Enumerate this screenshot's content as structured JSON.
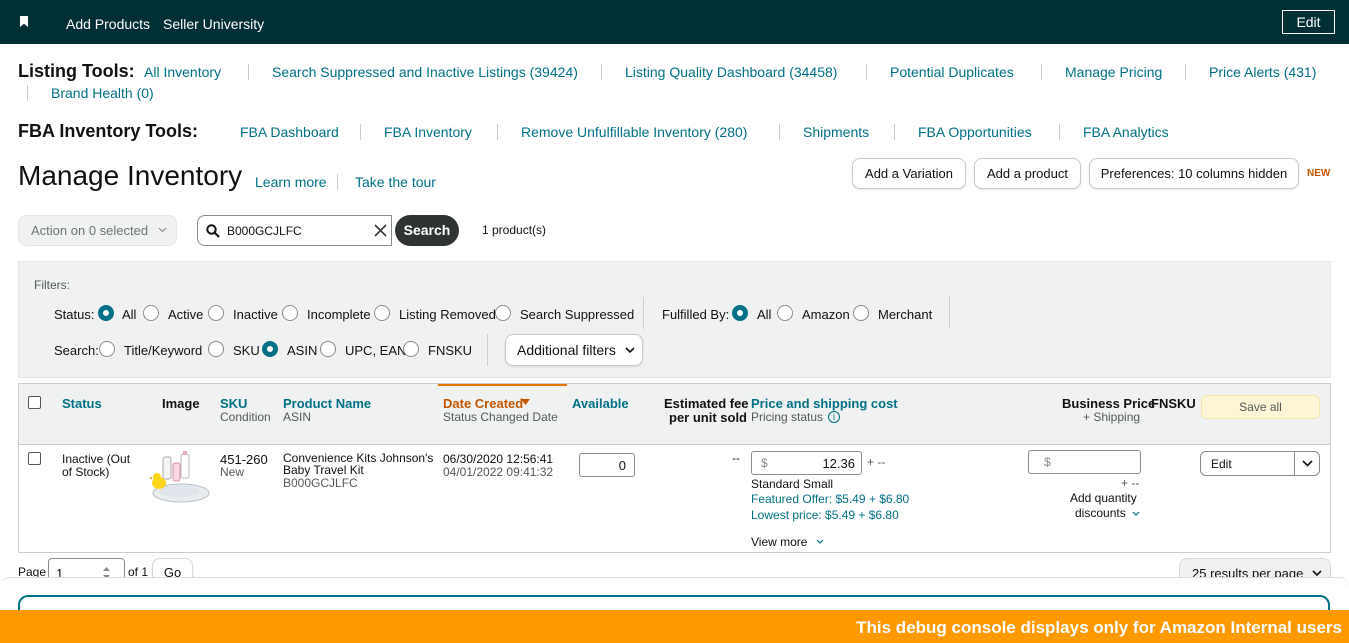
{
  "topbar": {
    "nav": [
      "Add Products",
      "Seller University"
    ],
    "edit_label": "Edit"
  },
  "listing_tools": {
    "label": "Listing Tools:",
    "links": [
      "All Inventory",
      "Search Suppressed and Inactive Listings (39424)",
      "Listing Quality Dashboard (34458)",
      "Potential Duplicates",
      "Manage Pricing",
      "Price Alerts (431)",
      "Brand Health (0)"
    ]
  },
  "fba_tools": {
    "label": "FBA Inventory Tools:",
    "links": [
      "FBA Dashboard",
      "FBA Inventory",
      "Remove Unfulfillable Inventory (280)",
      "Shipments",
      "FBA Opportunities",
      "FBA Analytics"
    ]
  },
  "header": {
    "title": "Manage Inventory",
    "learn_more": "Learn more",
    "take_tour": "Take the tour",
    "add_variation": "Add a Variation",
    "add_product": "Add a product",
    "preferences": "Preferences: 10 columns hidden",
    "new_tag": "NEW"
  },
  "search": {
    "action_label": "Action on 0 selected",
    "value": "B000GCJLFC",
    "button": "Search",
    "count": "1 product(s)"
  },
  "filters": {
    "title": "Filters:",
    "status_label": "Status:",
    "status_options": [
      "All",
      "Active",
      "Inactive",
      "Incomplete",
      "Listing Removed",
      "Search Suppressed"
    ],
    "fulfilled_label": "Fulfilled By:",
    "fulfilled_options": [
      "All",
      "Amazon",
      "Merchant"
    ],
    "search_label": "Search:",
    "search_options": [
      "Title/Keyword",
      "SKU",
      "ASIN",
      "UPC, EAN",
      "FNSKU"
    ],
    "additional": "Additional filters"
  },
  "table": {
    "headers": {
      "status": "Status",
      "image": "Image",
      "sku": "SKU",
      "condition": "Condition",
      "product_name": "Product Name",
      "asin": "ASIN",
      "date_created": "Date Created",
      "status_changed": "Status Changed Date",
      "available": "Available",
      "est_fee_1": "Estimated fee",
      "est_fee_2": "per unit sold",
      "price_shipping": "Price and shipping cost",
      "pricing_status": "Pricing status",
      "business_price": "Business Price",
      "plus_shipping": "+ Shipping",
      "fnsku": "FNSKU",
      "save_all": "Save all"
    },
    "row": {
      "status_1": "Inactive (Out",
      "status_2": "of Stock)",
      "sku": "451-260",
      "condition": "New",
      "name_1": "Convenience Kits Johnson's",
      "name_2": "Baby Travel Kit",
      "asin": "B000GCJLFC",
      "date_created": "06/30/2020 12:56:41",
      "status_changed": "04/01/2022 09:41:32",
      "available": "0",
      "est_fee": "--",
      "currency": "$",
      "price": "12.36",
      "shipping": "+ --",
      "size_tier": "Standard Small",
      "featured_offer": "Featured Offer: $5.49 + $6.80",
      "lowest_price": "Lowest price: $5.49 + $6.80",
      "view_more": "View more",
      "business_currency": "$",
      "business_shipping": "+ --",
      "add_qty_1": "Add quantity",
      "add_qty_2": "discounts",
      "edit": "Edit"
    }
  },
  "pagination": {
    "page_label": "Page",
    "page_value": "1",
    "of_label": "of 1",
    "go": "Go",
    "per_page": "25 results per page"
  },
  "debug_banner": "This debug console displays only for Amazon Internal users",
  "colors": {
    "topbar": "#002f36",
    "link": "#007185",
    "accent_orange": "#c45500",
    "debug": "#ff9900"
  }
}
